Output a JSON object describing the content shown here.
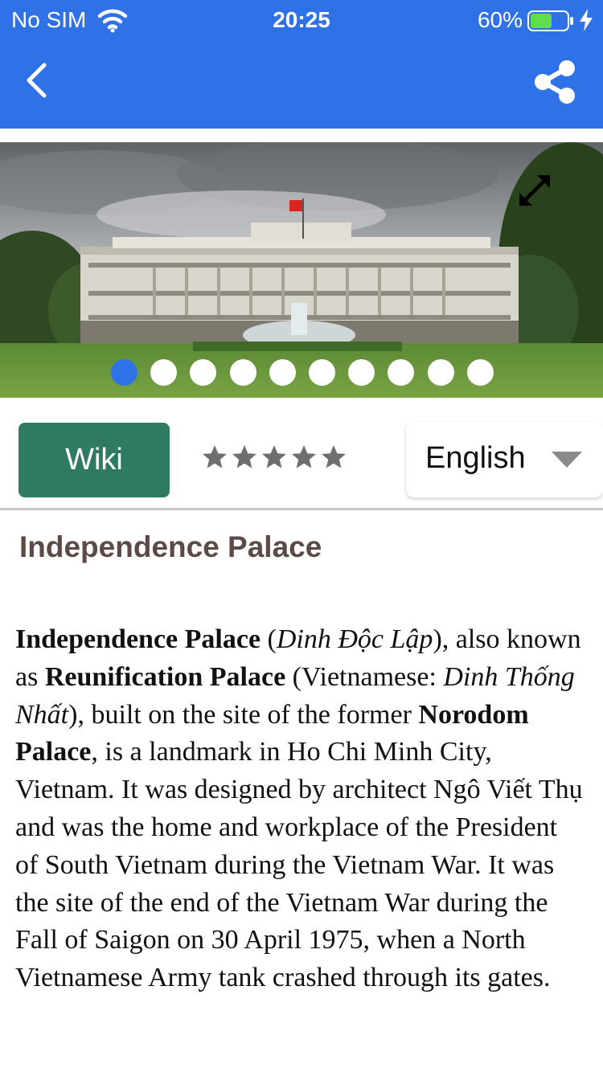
{
  "status": {
    "carrier": "No SIM",
    "time": "20:25",
    "battery": "60%",
    "battery_level": 0.6
  },
  "navbar": {
    "back_icon": "chevron-left-icon",
    "share_icon": "share-icon",
    "background": "#2f71e6"
  },
  "gallery": {
    "expand_icon": "expand-arrows-icon",
    "image_count": 10,
    "active_index": 0
  },
  "toolbar": {
    "wiki_label": "Wiki",
    "rating": 0,
    "rating_max": 5,
    "language": "English",
    "wiki_color": "#2f7a63"
  },
  "place": {
    "title": "Independence Palace",
    "article": {
      "s1_name": "Independence Palace",
      "s2": " (",
      "s3_alt": "Dinh Độc Lập",
      "s4": "), also known as ",
      "s5_name2": "Reunification Palace",
      "s6": " (Vietnamese: ",
      "s7_alt2": "Dinh Thống Nhất",
      "s8": "), built on the site of the former ",
      "s9_former": "Norodom Palace",
      "s10": ", is a landmark in Ho Chi Minh City, Vietnam. It was designed by architect Ngô Viết Thụ and was the home and workplace of the President of South Vietnam during the Vietnam War. It was the site of the end of the Vietnam War during the Fall of Saigon on 30 April 1975, when a North Vietnamese Army tank crashed through its gates."
    }
  }
}
